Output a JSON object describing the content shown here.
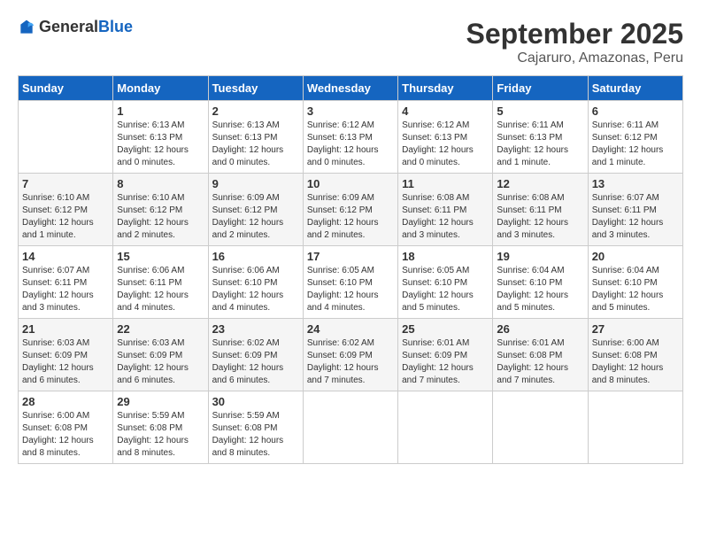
{
  "logo": {
    "text_general": "General",
    "text_blue": "Blue"
  },
  "header": {
    "month": "September 2025",
    "location": "Cajaruro, Amazonas, Peru"
  },
  "days_of_week": [
    "Sunday",
    "Monday",
    "Tuesday",
    "Wednesday",
    "Thursday",
    "Friday",
    "Saturday"
  ],
  "weeks": [
    [
      {
        "day": "",
        "info": ""
      },
      {
        "day": "1",
        "info": "Sunrise: 6:13 AM\nSunset: 6:13 PM\nDaylight: 12 hours\nand 0 minutes."
      },
      {
        "day": "2",
        "info": "Sunrise: 6:13 AM\nSunset: 6:13 PM\nDaylight: 12 hours\nand 0 minutes."
      },
      {
        "day": "3",
        "info": "Sunrise: 6:12 AM\nSunset: 6:13 PM\nDaylight: 12 hours\nand 0 minutes."
      },
      {
        "day": "4",
        "info": "Sunrise: 6:12 AM\nSunset: 6:13 PM\nDaylight: 12 hours\nand 0 minutes."
      },
      {
        "day": "5",
        "info": "Sunrise: 6:11 AM\nSunset: 6:13 PM\nDaylight: 12 hours\nand 1 minute."
      },
      {
        "day": "6",
        "info": "Sunrise: 6:11 AM\nSunset: 6:12 PM\nDaylight: 12 hours\nand 1 minute."
      }
    ],
    [
      {
        "day": "7",
        "info": "Sunrise: 6:10 AM\nSunset: 6:12 PM\nDaylight: 12 hours\nand 1 minute."
      },
      {
        "day": "8",
        "info": "Sunrise: 6:10 AM\nSunset: 6:12 PM\nDaylight: 12 hours\nand 2 minutes."
      },
      {
        "day": "9",
        "info": "Sunrise: 6:09 AM\nSunset: 6:12 PM\nDaylight: 12 hours\nand 2 minutes."
      },
      {
        "day": "10",
        "info": "Sunrise: 6:09 AM\nSunset: 6:12 PM\nDaylight: 12 hours\nand 2 minutes."
      },
      {
        "day": "11",
        "info": "Sunrise: 6:08 AM\nSunset: 6:11 PM\nDaylight: 12 hours\nand 3 minutes."
      },
      {
        "day": "12",
        "info": "Sunrise: 6:08 AM\nSunset: 6:11 PM\nDaylight: 12 hours\nand 3 minutes."
      },
      {
        "day": "13",
        "info": "Sunrise: 6:07 AM\nSunset: 6:11 PM\nDaylight: 12 hours\nand 3 minutes."
      }
    ],
    [
      {
        "day": "14",
        "info": "Sunrise: 6:07 AM\nSunset: 6:11 PM\nDaylight: 12 hours\nand 3 minutes."
      },
      {
        "day": "15",
        "info": "Sunrise: 6:06 AM\nSunset: 6:11 PM\nDaylight: 12 hours\nand 4 minutes."
      },
      {
        "day": "16",
        "info": "Sunrise: 6:06 AM\nSunset: 6:10 PM\nDaylight: 12 hours\nand 4 minutes."
      },
      {
        "day": "17",
        "info": "Sunrise: 6:05 AM\nSunset: 6:10 PM\nDaylight: 12 hours\nand 4 minutes."
      },
      {
        "day": "18",
        "info": "Sunrise: 6:05 AM\nSunset: 6:10 PM\nDaylight: 12 hours\nand 5 minutes."
      },
      {
        "day": "19",
        "info": "Sunrise: 6:04 AM\nSunset: 6:10 PM\nDaylight: 12 hours\nand 5 minutes."
      },
      {
        "day": "20",
        "info": "Sunrise: 6:04 AM\nSunset: 6:10 PM\nDaylight: 12 hours\nand 5 minutes."
      }
    ],
    [
      {
        "day": "21",
        "info": "Sunrise: 6:03 AM\nSunset: 6:09 PM\nDaylight: 12 hours\nand 6 minutes."
      },
      {
        "day": "22",
        "info": "Sunrise: 6:03 AM\nSunset: 6:09 PM\nDaylight: 12 hours\nand 6 minutes."
      },
      {
        "day": "23",
        "info": "Sunrise: 6:02 AM\nSunset: 6:09 PM\nDaylight: 12 hours\nand 6 minutes."
      },
      {
        "day": "24",
        "info": "Sunrise: 6:02 AM\nSunset: 6:09 PM\nDaylight: 12 hours\nand 7 minutes."
      },
      {
        "day": "25",
        "info": "Sunrise: 6:01 AM\nSunset: 6:09 PM\nDaylight: 12 hours\nand 7 minutes."
      },
      {
        "day": "26",
        "info": "Sunrise: 6:01 AM\nSunset: 6:08 PM\nDaylight: 12 hours\nand 7 minutes."
      },
      {
        "day": "27",
        "info": "Sunrise: 6:00 AM\nSunset: 6:08 PM\nDaylight: 12 hours\nand 8 minutes."
      }
    ],
    [
      {
        "day": "28",
        "info": "Sunrise: 6:00 AM\nSunset: 6:08 PM\nDaylight: 12 hours\nand 8 minutes."
      },
      {
        "day": "29",
        "info": "Sunrise: 5:59 AM\nSunset: 6:08 PM\nDaylight: 12 hours\nand 8 minutes."
      },
      {
        "day": "30",
        "info": "Sunrise: 5:59 AM\nSunset: 6:08 PM\nDaylight: 12 hours\nand 8 minutes."
      },
      {
        "day": "",
        "info": ""
      },
      {
        "day": "",
        "info": ""
      },
      {
        "day": "",
        "info": ""
      },
      {
        "day": "",
        "info": ""
      }
    ]
  ]
}
